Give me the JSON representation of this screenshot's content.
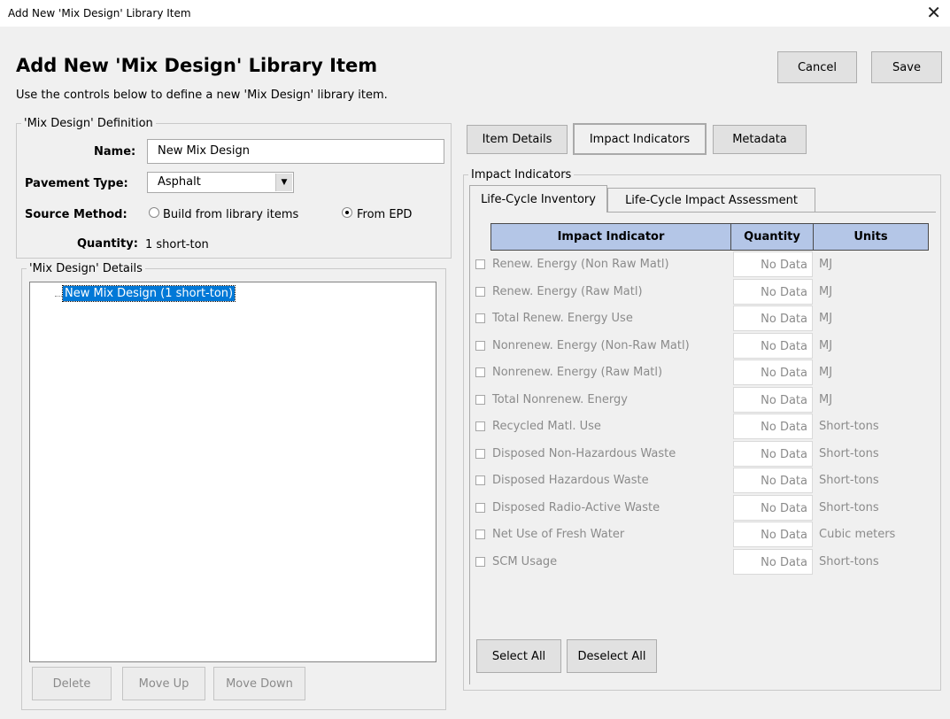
{
  "window": {
    "title": "Add New 'Mix Design' Library Item",
    "close_glyph": "✕"
  },
  "header": {
    "heading": "Add New 'Mix Design' Library Item",
    "instructions": "Use the controls below to define a new 'Mix Design' library item."
  },
  "buttons": {
    "cancel": "Cancel",
    "save": "Save"
  },
  "definition": {
    "legend": "'Mix Design' Definition",
    "name_label": "Name:",
    "name_value": "New Mix Design",
    "pavement_label": "Pavement Type:",
    "pavement_value": "Asphalt",
    "source_label": "Source Method:",
    "source_options": [
      "Build from library items",
      "From EPD"
    ],
    "source_selected": "From EPD",
    "quantity_label": "Quantity:",
    "quantity_value": "1 short-ton"
  },
  "details": {
    "legend": "'Mix Design' Details",
    "tree_item": "New Mix Design (1 short-ton)",
    "buttons": {
      "delete": "Delete",
      "move_up": "Move Up",
      "move_down": "Move Down"
    }
  },
  "tabs": {
    "item_details": "Item Details",
    "impact_indicators": "Impact Indicators",
    "metadata": "Metadata",
    "active": "Impact Indicators"
  },
  "impact": {
    "legend": "Impact Indicators",
    "subtabs": {
      "lci": "Life-Cycle Inventory",
      "lcia": "Life-Cycle Impact Assessment",
      "active": "Life-Cycle Inventory"
    },
    "columns": {
      "indicator": "Impact Indicator",
      "quantity": "Quantity",
      "units": "Units"
    },
    "rows": [
      {
        "name": "Renew. Energy (Non Raw Matl)",
        "quantity": "No Data",
        "units": "MJ"
      },
      {
        "name": "Renew. Energy (Raw Matl)",
        "quantity": "No Data",
        "units": "MJ"
      },
      {
        "name": "Total Renew. Energy Use",
        "quantity": "No Data",
        "units": "MJ"
      },
      {
        "name": "Nonrenew. Energy (Non-Raw Matl)",
        "quantity": "No Data",
        "units": "MJ"
      },
      {
        "name": "Nonrenew. Energy (Raw Matl)",
        "quantity": "No Data",
        "units": "MJ"
      },
      {
        "name": "Total Nonrenew. Energy",
        "quantity": "No Data",
        "units": "MJ"
      },
      {
        "name": "Recycled Matl. Use",
        "quantity": "No Data",
        "units": "Short-tons"
      },
      {
        "name": "Disposed Non-Hazardous Waste",
        "quantity": "No Data",
        "units": "Short-tons"
      },
      {
        "name": "Disposed Hazardous Waste",
        "quantity": "No Data",
        "units": "Short-tons"
      },
      {
        "name": "Disposed Radio-Active Waste",
        "quantity": "No Data",
        "units": "Short-tons"
      },
      {
        "name": "Net Use of Fresh Water",
        "quantity": "No Data",
        "units": "Cubic meters"
      },
      {
        "name": "SCM Usage",
        "quantity": "No Data",
        "units": "Short-tons"
      }
    ],
    "select_all": "Select All",
    "deselect_all": "Deselect All"
  },
  "colors": {
    "header_fill": "#b4c6e7",
    "selection": "#0078d7"
  }
}
